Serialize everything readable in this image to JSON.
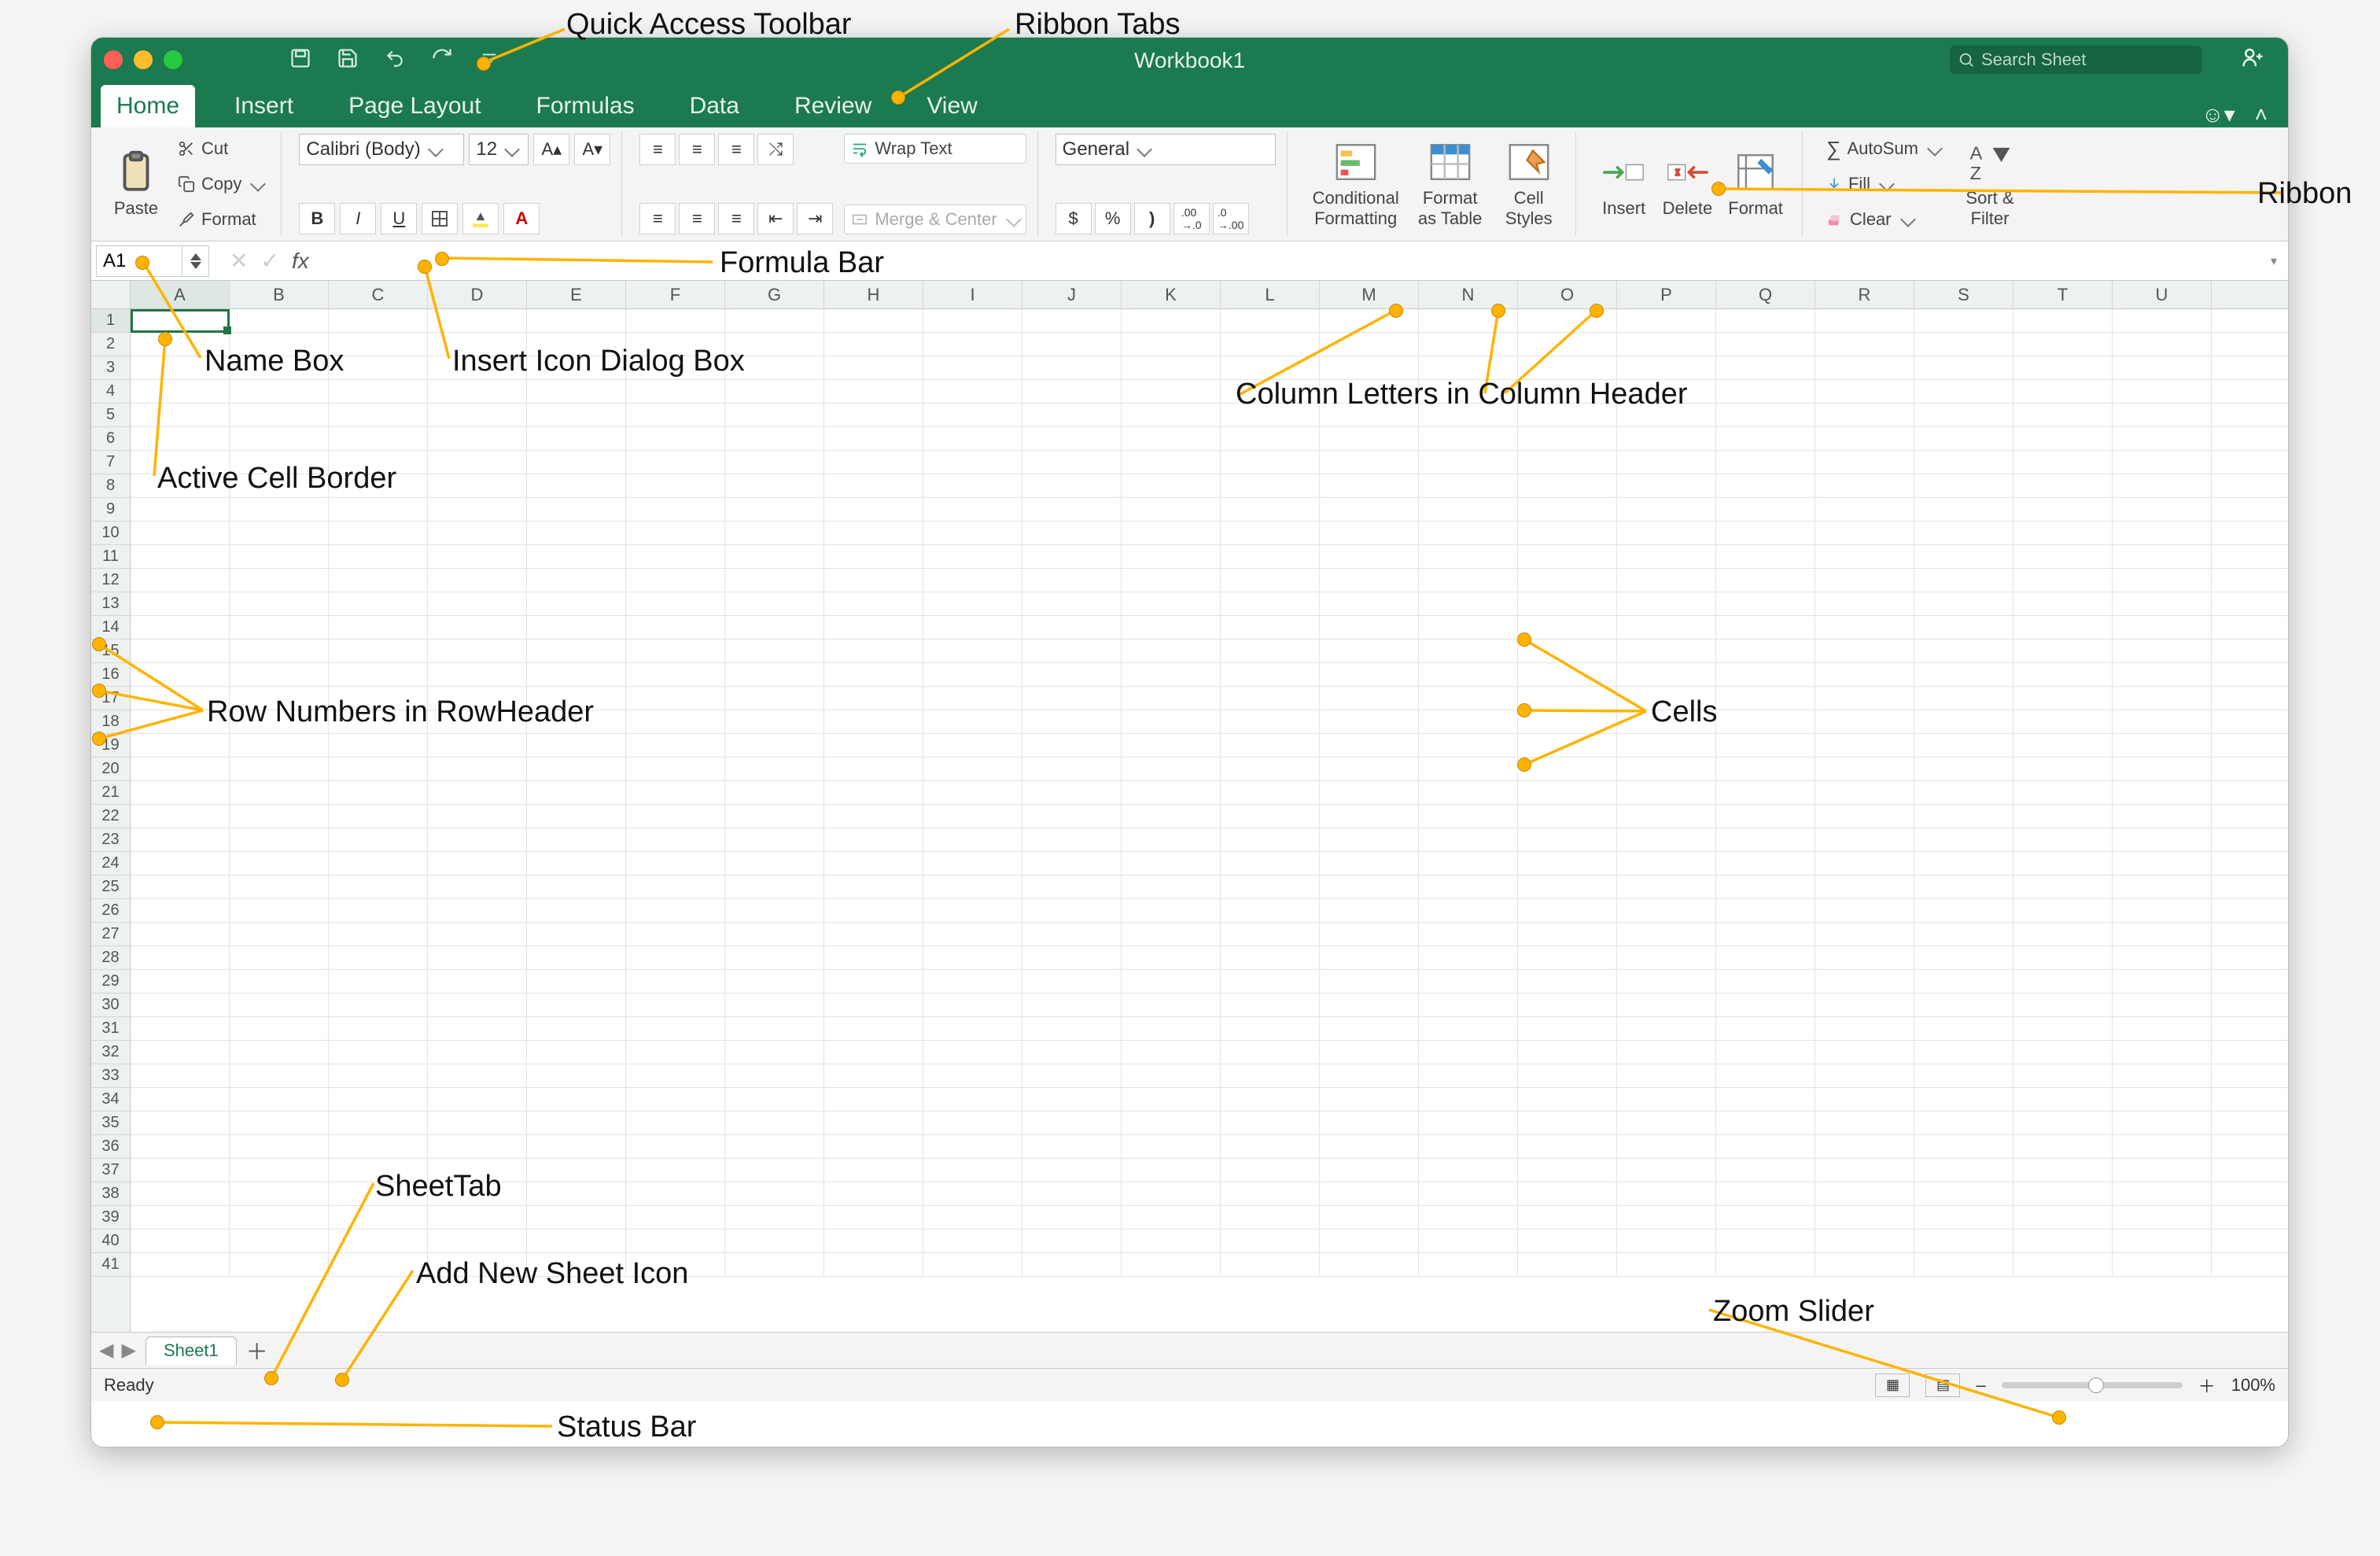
{
  "window": {
    "title": "Workbook1",
    "search_placeholder": "Search Sheet"
  },
  "qat": {
    "tooltip_save": "Save",
    "tooltip_undo": "Undo",
    "tooltip_redo": "Redo"
  },
  "tabs": [
    "Home",
    "Insert",
    "Page Layout",
    "Formulas",
    "Data",
    "Review",
    "View"
  ],
  "active_tab": "Home",
  "ribbon": {
    "clipboard": {
      "paste": "Paste",
      "cut": "Cut",
      "copy": "Copy",
      "format": "Format"
    },
    "font": {
      "name": "Calibri (Body)",
      "size": "12",
      "bold": "B",
      "italic": "I",
      "underline": "U"
    },
    "align": {
      "wrap": "Wrap Text",
      "merge": "Merge & Center"
    },
    "number": {
      "format": "General",
      "currency": "$",
      "percent": "%",
      "comma": ",",
      "inc": ".00→.0",
      "dec": ".0→.00"
    },
    "styles": {
      "cond": "Conditional Formatting",
      "table": "Format as Table",
      "cell": "Cell Styles"
    },
    "cells": {
      "insert": "Insert",
      "delete": "Delete",
      "format": "Format"
    },
    "editing": {
      "autosum": "AutoSum",
      "fill": "Fill",
      "clear": "Clear",
      "sort": "Sort & Filter"
    }
  },
  "namebox": "A1",
  "columns": [
    "A",
    "B",
    "C",
    "D",
    "E",
    "F",
    "G",
    "H",
    "I",
    "J",
    "K",
    "L",
    "M",
    "N",
    "O",
    "P",
    "Q",
    "R",
    "S",
    "T",
    "U"
  ],
  "rows": 41,
  "sheet": {
    "name": "Sheet1"
  },
  "status": {
    "text": "Ready",
    "zoom": "100%"
  },
  "labels": {
    "qat": "Quick Access Toolbar",
    "ribtabs": "Ribbon Tabs",
    "ribbon": "Ribbon",
    "fbar": "Formula Bar",
    "nbox": "Name Box",
    "fx": "Insert Icon Dialog Box",
    "active": "Active Cell Border",
    "colhdr": "Column Letters in Column Header",
    "rowhdr": "Row Numbers in RowHeader",
    "cells": "Cells",
    "stab": "SheetTab",
    "addsheet": "Add New Sheet Icon",
    "status": "Status Bar",
    "zoom": "Zoom Slider"
  }
}
